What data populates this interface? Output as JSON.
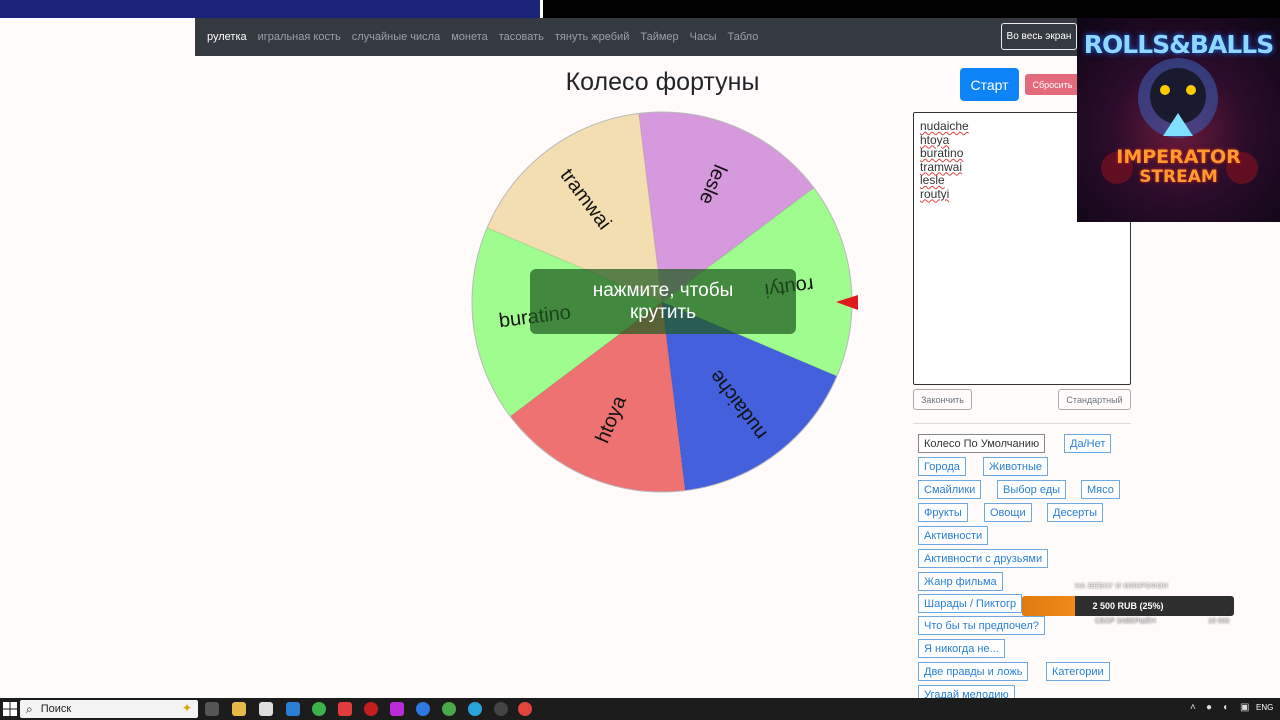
{
  "nav": {
    "items": [
      "рулетка",
      "игральная кость",
      "случайные числа",
      "монета",
      "тасовать",
      "тянуть жребий",
      "Таймер",
      "Часы",
      "Табло"
    ],
    "fullscreen_label": "Во весь экран"
  },
  "title": "Колесо фортуны",
  "wheel": {
    "overlay_line1": "нажмите, чтобы",
    "overlay_line2": "крутить",
    "segments": [
      {
        "label": "routyi",
        "color": "#9ffd8f"
      },
      {
        "label": "nudaiche",
        "color": "#4460dc"
      },
      {
        "label": "htoya",
        "color": "#ef7272"
      },
      {
        "label": "buratino",
        "color": "#9ffd8f"
      },
      {
        "label": "tramwai",
        "color": "#f3deb2"
      },
      {
        "label": "lesle",
        "color": "#d699dd"
      }
    ],
    "pointer_color": "#e0191f"
  },
  "controls": {
    "start_label": "Старт",
    "reset_label": "Сбросить",
    "finish_label": "Закончить",
    "standard_label": "Стандартный"
  },
  "names": [
    "nudaiche",
    "htoya",
    "buratino",
    "tramwai",
    "lesle",
    "routyi"
  ],
  "presets": [
    "Колесо По Умолчанию",
    "Да/Нет",
    "Города",
    "Животные",
    "Смайлики",
    "Выбор еды",
    "Мясо",
    "Фрукты",
    "Овощи",
    "Десерты",
    "Активности",
    "Активности с друзьями",
    "Жанр фильма",
    "Шарады / Пиктогр",
    "Что бы ты предпочел?",
    "Я никогда не...",
    "Две правды и ложь",
    "Категории",
    "Угадай мелодию"
  ],
  "stream_overlay": {
    "logo_top": "ROLLS&BALLS",
    "logo_bottom1": "IMPERATOR",
    "logo_bottom2": "STREAM",
    "goal_title": "НА ВЕБКУ И МИКРОФОН",
    "goal_amount_text": "2 500 RUB (25%)",
    "goal_progress": 0.25,
    "goal_sub": "СБОР ЗАВЕРШЁН",
    "goal_max": "10 000"
  },
  "taskbar": {
    "search_placeholder": "Поиск",
    "language": "ENG"
  }
}
